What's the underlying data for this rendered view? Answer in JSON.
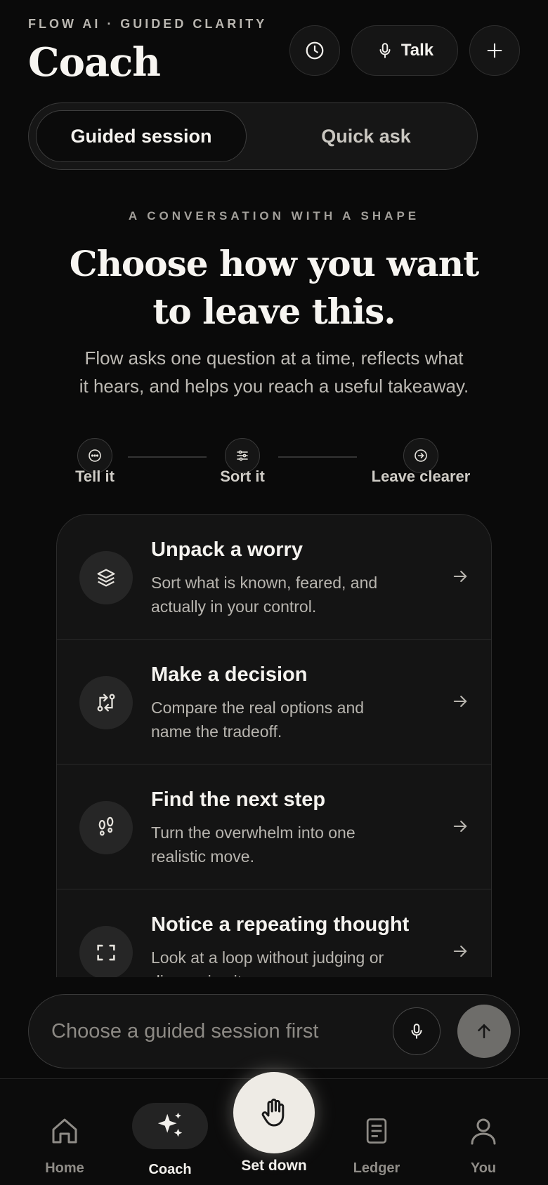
{
  "header": {
    "eyebrow": "FLOW AI · GUIDED CLARITY",
    "title": "Coach",
    "history_icon": "clock-icon",
    "talk_label": "Talk",
    "talk_icon": "microphone-icon",
    "plus_icon": "plus-icon"
  },
  "segmented": {
    "active": "Guided session",
    "inactive": "Quick ask"
  },
  "intro": {
    "kicker": "A CONVERSATION WITH A SHAPE",
    "headline_line1": "Choose how you want",
    "headline_line2": "to leave this.",
    "sub_line1": "Flow asks one question at a time, reflects what",
    "sub_line2": "it hears, and helps you reach a useful takeaway."
  },
  "steps": [
    {
      "label": "Tell it",
      "icon": "chat-bubble-icon"
    },
    {
      "label": "Sort it",
      "icon": "sliders-icon"
    },
    {
      "label": "Leave clearer",
      "icon": "arrow-circle-icon"
    }
  ],
  "sessions": [
    {
      "title": "Unpack a worry",
      "desc_line1": "Sort what is known, feared, and",
      "desc_line2": "actually in your control.",
      "icon": "layers-icon"
    },
    {
      "title": "Make a decision",
      "desc_line1": "Compare the real options and",
      "desc_line2": "name the tradeoff.",
      "icon": "swap-icon"
    },
    {
      "title": "Find the next step",
      "desc_line1": "Turn the overwhelm into one",
      "desc_line2": "realistic move.",
      "icon": "footprints-icon"
    },
    {
      "title": "Notice a repeating thought",
      "desc_line1": "Look at a loop without judging or",
      "desc_line2": "diagnosing it.",
      "icon": "focus-frame-icon"
    }
  ],
  "composer": {
    "placeholder": "Choose a guided session first",
    "value": ""
  },
  "nav": {
    "home": "Home",
    "coach": "Coach",
    "setdown": "Set down",
    "ledger": "Ledger",
    "you": "You"
  },
  "colors": {
    "background": "#0a0a0a",
    "surface": "#141414",
    "text": "#f2f0ec",
    "muted": "#bdbab4",
    "setdown_button": "#eeebe5",
    "send_button": "#6e6d6a"
  }
}
